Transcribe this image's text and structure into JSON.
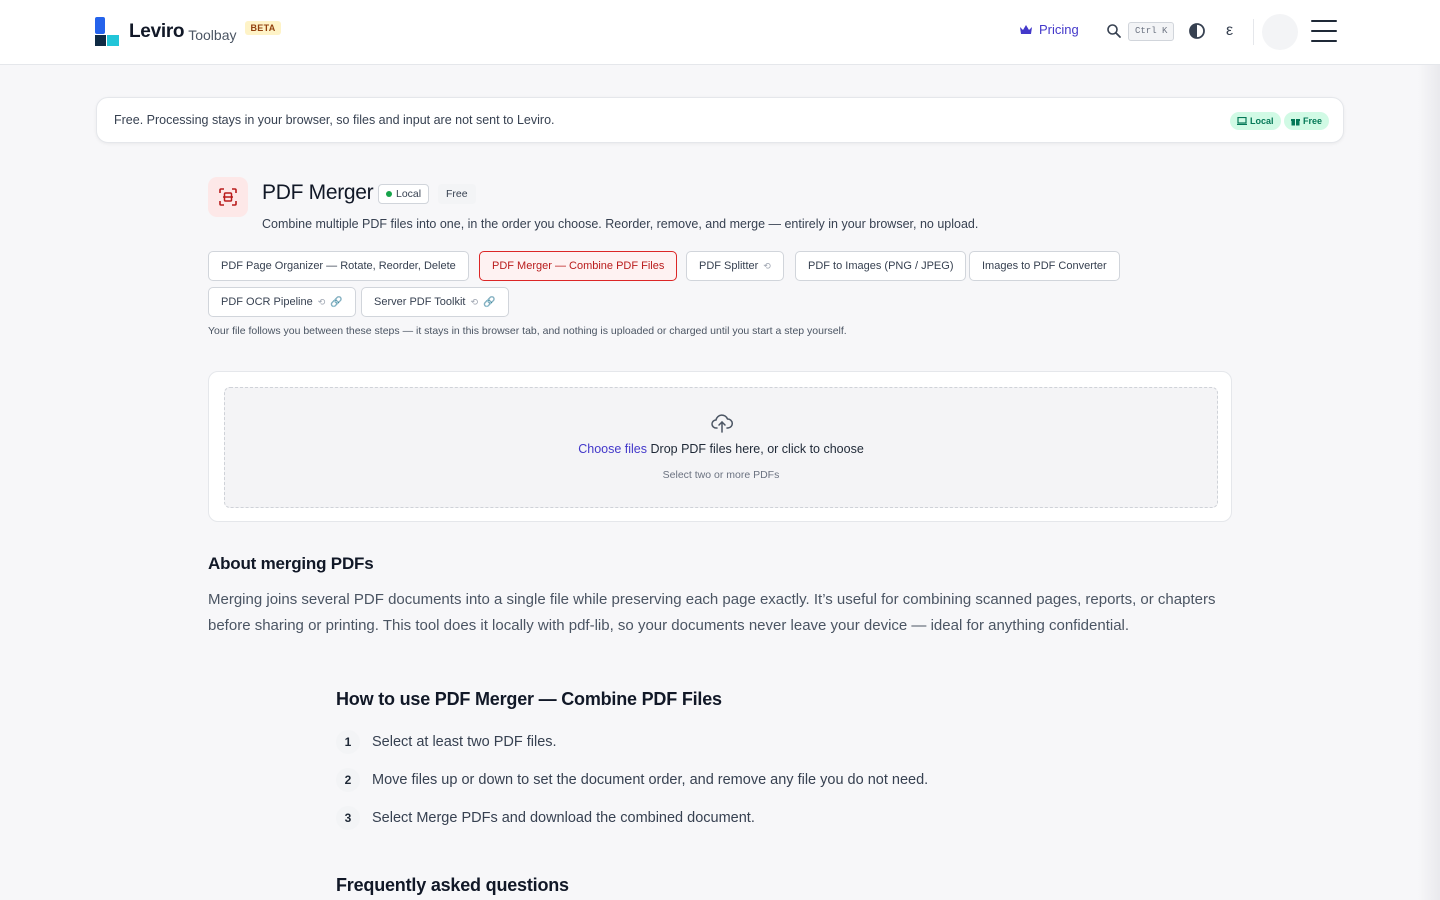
{
  "header": {
    "logo_name": "Leviro",
    "logo_sub": "Toolbay",
    "beta": "BETA",
    "pricing": "Pricing",
    "shortcut": "Ctrl K",
    "lang": "ε"
  },
  "notice": {
    "text": "Free. Processing stays in your browser, so files and input are not sent to Leviro.",
    "badges": [
      "Local",
      "Free"
    ]
  },
  "tool": {
    "title": "PDF Merger",
    "badge_local": "Local",
    "badge_free": "Free",
    "description": "Combine multiple PDF files into one, in the order you choose. Reorder, remove, and merge — entirely in your browser, no upload."
  },
  "related": {
    "items": [
      {
        "label": "PDF Page Organizer — Rotate, Reorder, Delete"
      },
      {
        "label": "PDF Merger — Combine PDF Files",
        "active": true
      },
      {
        "label": "PDF Splitter"
      },
      {
        "label": "PDF to Images (PNG / JPEG)"
      },
      {
        "label": "Images to PDF Converter"
      },
      {
        "label": "PDF OCR Pipeline"
      },
      {
        "label": "Server PDF Toolkit"
      }
    ],
    "note": "Your file follows you between these steps — it stays in this browser tab, and nothing is uploaded or charged until you start a step yourself."
  },
  "upload": {
    "choose": "Choose files",
    "drop": "Drop PDF files here, or click to choose",
    "hint": "Select two or more PDFs"
  },
  "about": {
    "title": "About merging PDFs",
    "text": "Merging joins several PDF documents into a single file while preserving each page exactly. It’s useful for combining scanned pages, reports, or chapters before sharing or printing. This tool does it locally with pdf-lib, so your documents never leave your device — ideal for anything confidential."
  },
  "howto": {
    "title": "How to use PDF Merger — Combine PDF Files",
    "steps": [
      {
        "num": "1",
        "text": "Select at least two PDF files."
      },
      {
        "num": "2",
        "text": "Move files up or down to set the document order, and remove any file you do not need."
      },
      {
        "num": "3",
        "text": "Select Merge PDFs and download the combined document."
      }
    ]
  },
  "faq": {
    "title": "Frequently asked questions"
  },
  "colors": {
    "accent": "#4338ca",
    "active_chip": "#dc2626",
    "badge_green": "#047857"
  },
  "icons": [
    "logo-mark",
    "crown-icon",
    "search-icon",
    "contrast-icon",
    "menu-icon",
    "monitor-icon",
    "gift-icon",
    "scan-icon",
    "cloud-upload-icon",
    "sync-icon",
    "link-icon"
  ]
}
